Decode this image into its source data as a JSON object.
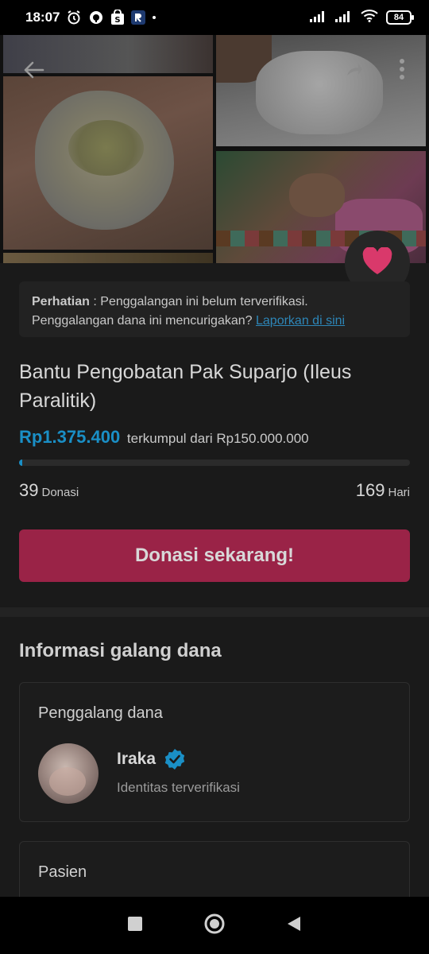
{
  "status_bar": {
    "time": "18:07",
    "battery": "84"
  },
  "hero": {
    "back_icon": "arrow-left-icon",
    "share_icon": "share-icon",
    "more_icon": "more-vertical-icon",
    "favorite_icon": "heart-icon"
  },
  "notice": {
    "label": "Perhatian",
    "separator": " : ",
    "text1": "Penggalangan ini belum terverifikasi.",
    "text2": "Penggalangan dana ini mencurigakan? ",
    "link": "Laporkan di sini"
  },
  "campaign": {
    "title": "Bantu Pengobatan Pak Suparjo (Ileus Paralitik)",
    "collected": "Rp1.375.400",
    "collected_suffix": " terkumpul dari Rp150.000.000",
    "progress_fraction": 0.009,
    "donations_count": "39",
    "donations_label": "Donasi",
    "days_count": "169",
    "days_label": "Hari",
    "donate_button": "Donasi sekarang!"
  },
  "info": {
    "section_title": "Informasi galang dana",
    "organizer_label": "Penggalang dana",
    "organizer_name": "Iraka",
    "organizer_status": "Identitas terverifikasi",
    "patient_label": "Pasien"
  },
  "colors": {
    "accent_blue": "#1a8fc6",
    "donate_button": "#9a2347",
    "favorite_heart": "#d9396b"
  }
}
